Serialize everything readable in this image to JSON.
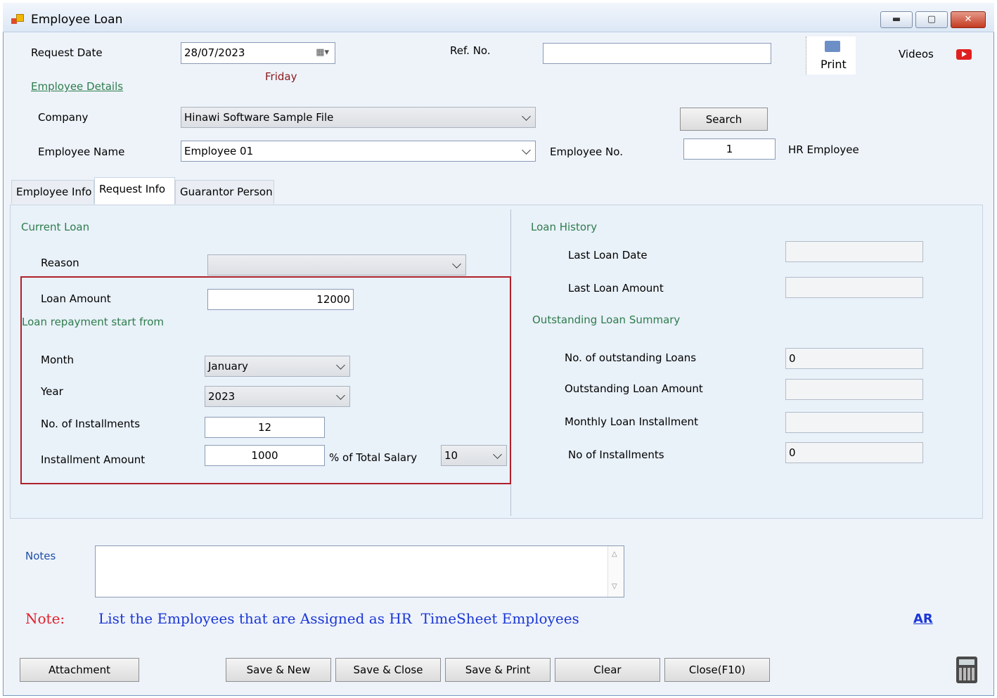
{
  "window": {
    "title": "Employee Loan",
    "min_icon": "minimize-icon",
    "max_icon": "maximize-icon",
    "close_icon": "close-icon"
  },
  "header": {
    "request_date_label": "Request Date",
    "request_date_value": "28/07/2023",
    "day_name": "Friday",
    "ref_label": "Ref. No.",
    "ref_value": "",
    "print_label": "Print",
    "videos_label": "Videos",
    "employee_details_link": "Employee Details",
    "company_label": "Company",
    "company_value": "Hinawi Software Sample File",
    "search_label": "Search",
    "employee_name_label": "Employee Name",
    "employee_name_value": "Employee 01",
    "employee_no_label": "Employee No.",
    "employee_no_value": "1",
    "hr_employee_label": "HR Employee"
  },
  "tabs": [
    {
      "label": "Employee Info"
    },
    {
      "label": "Request Info"
    },
    {
      "label": "Guarantor Person"
    }
  ],
  "current_loan": {
    "heading": "Current Loan",
    "reason_label": "Reason",
    "reason_value": "",
    "loan_amount_label": "Loan Amount",
    "loan_amount_value": "12000",
    "repayment_heading": "Loan repayment start from",
    "month_label": "Month",
    "month_value": "January",
    "year_label": "Year",
    "year_value": "2023",
    "installments_label": "No. of Installments",
    "installments_value": "12",
    "installment_amount_label": "Installment Amount",
    "installment_amount_value": "1000",
    "pct_label": "% of Total Salary",
    "pct_value": "10"
  },
  "loan_history": {
    "heading": "Loan History",
    "last_date_label": "Last Loan Date",
    "last_date_value": "",
    "last_amount_label": "Last Loan Amount",
    "last_amount_value": "",
    "outstanding_heading": "Outstanding Loan Summary",
    "num_outstanding_label": "No. of outstanding Loans",
    "num_outstanding_value": "0",
    "outstanding_amount_label": "Outstanding Loan Amount",
    "outstanding_amount_value": "",
    "monthly_installment_label": "Monthly Loan Installment",
    "monthly_installment_value": "",
    "num_installments_label": "No of Installments",
    "num_installments_value": "0"
  },
  "notes": {
    "label": "Notes",
    "value": ""
  },
  "note_line": {
    "prefix": "Note:",
    "text": "List the Employees that are Assigned as HR  TimeSheet Employees",
    "ar_link": "AR"
  },
  "footer": {
    "attachment": "Attachment",
    "save_new": "Save & New",
    "save_close": "Save & Close",
    "save_print": "Save & Print",
    "clear": "Clear",
    "close": "Close(F10)"
  },
  "colors": {
    "accent_green": "#2e7d4c",
    "note_red": "#e0202a",
    "note_blue": "#1a36d6",
    "highlight_red": "#b0202a"
  }
}
